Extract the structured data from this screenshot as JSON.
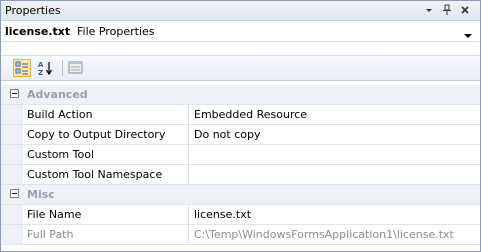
{
  "window": {
    "title": "Properties"
  },
  "object_selector": {
    "name": "license.txt",
    "type": "File Properties"
  },
  "categories": [
    {
      "label": "Advanced",
      "expanded": true,
      "properties": [
        {
          "name": "Build Action",
          "value": "Embedded Resource",
          "readonly": false
        },
        {
          "name": "Copy to Output Directory",
          "value": "Do not copy",
          "readonly": false
        },
        {
          "name": "Custom Tool",
          "value": "",
          "readonly": false
        },
        {
          "name": "Custom Tool Namespace",
          "value": "",
          "readonly": false
        }
      ]
    },
    {
      "label": "Misc",
      "expanded": true,
      "properties": [
        {
          "name": "File Name",
          "value": "license.txt",
          "readonly": false
        },
        {
          "name": "Full Path",
          "value": "C:\\Temp\\WindowsFormsApplication1\\license.txt",
          "readonly": true
        }
      ]
    }
  ],
  "toolbar": {
    "categorized_icon": "categorized-icon",
    "alphabetical_icon": "alphabetical-icon",
    "property_pages_icon": "property-pages-icon",
    "active_view": "categorized"
  },
  "colors": {
    "titlebar": "#dfe6f1",
    "gutter": "#eef1f6",
    "active_button": "#ffe8a6",
    "readonly_text": "#8c8c8c"
  }
}
